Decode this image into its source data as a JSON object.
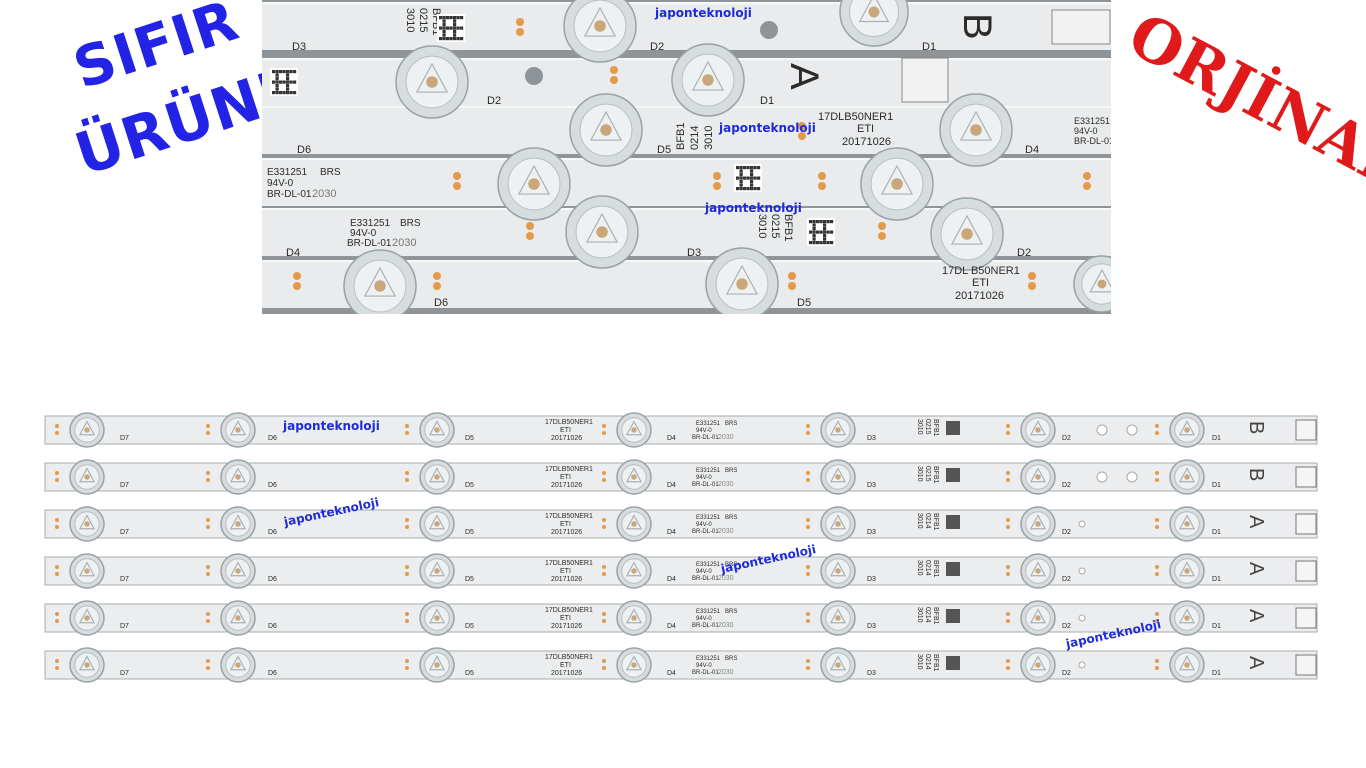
{
  "stamps": {
    "left_line1": "SIFIR",
    "left_line2": "ÜRÜNDÜR",
    "right": "ORJİNAL"
  },
  "watermark": "japonteknoloji",
  "closeup": {
    "labels": {
      "strip_b_letter": "B",
      "strip_a_letter": "A",
      "model": "17DLB50NER1",
      "eti": "ETI",
      "date": "20171026",
      "cert": "E331251",
      "brs": "BRS",
      "rating": "94V-0",
      "code": "BR-DL-01",
      "code_num": "2030",
      "batch1": "3010",
      "batch2": "0215",
      "batch3": "0214",
      "bfb": "BFB1",
      "model_partial": "17DL B50NER1"
    },
    "diodes": [
      "D1",
      "D2",
      "D3",
      "D4",
      "D5",
      "D6"
    ]
  },
  "strips": {
    "diodes": [
      "D7",
      "D6",
      "D5",
      "D4",
      "D3",
      "D2",
      "D1"
    ],
    "model": "17DLB50NER1",
    "eti": "ETI",
    "date": "20171026",
    "cert": "E331251",
    "brs": "BRS",
    "rating": "94V-0",
    "code": "BR-DL-01",
    "code_num": "2030",
    "batch1": "3010",
    "batch2_b": "0215",
    "batch2_a": "0214",
    "bfb": "BFB1",
    "rows": [
      {
        "letter": "B"
      },
      {
        "letter": "B"
      },
      {
        "letter": "A"
      },
      {
        "letter": "A"
      },
      {
        "letter": "A"
      },
      {
        "letter": "A"
      }
    ]
  }
}
